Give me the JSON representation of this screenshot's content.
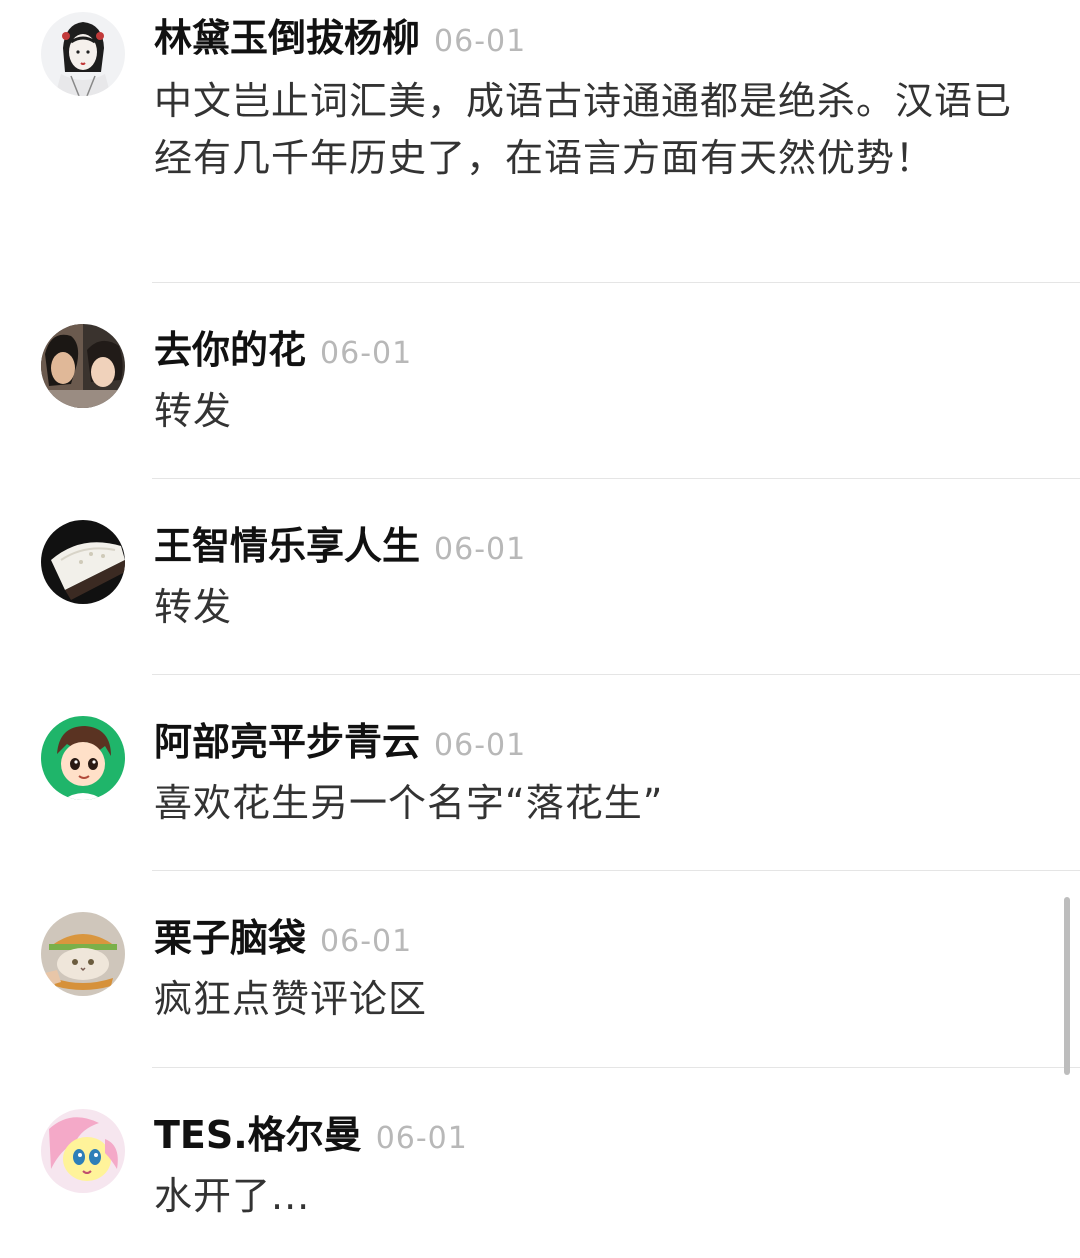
{
  "comments": [
    {
      "name": "林黛玉倒拔杨柳",
      "date": "06-01",
      "text": "中文岂止词汇美，成语古诗通通都是绝杀。汉语已经有几千年历史了，在语言方面有天然优势！",
      "avatar_icon": "ink-portrait-avatar-icon"
    },
    {
      "name": "去你的花",
      "date": "06-01",
      "text": "转发",
      "avatar_icon": "couple-photo-avatar-icon"
    },
    {
      "name": "王智情乐享人生",
      "date": "06-01",
      "text": "转发",
      "avatar_icon": "cake-slice-avatar-icon"
    },
    {
      "name": "阿部亮平步青云",
      "date": "06-01",
      "text": "喜欢花生另一个名字“落花生”",
      "avatar_icon": "cartoon-boy-avatar-icon"
    },
    {
      "name": "栗子脑袋",
      "date": "06-01",
      "text": "疯狂点赞评论区",
      "avatar_icon": "burger-cat-avatar-icon"
    },
    {
      "name": "TES.格尔曼",
      "date": "06-01",
      "text": "水开了...",
      "avatar_icon": "pony-avatar-icon"
    }
  ],
  "colors": {
    "name": "#111111",
    "date": "#b8b8b8",
    "text": "#333333",
    "divider": "#e5e5e5",
    "scrollbar": "#bdbdbd"
  }
}
